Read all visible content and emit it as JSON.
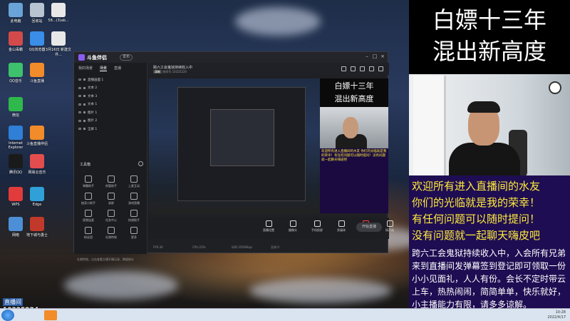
{
  "desktop": {
    "icons": [
      {
        "label": "此电脑",
        "color": "#6aa3d8"
      },
      {
        "label": "回收站",
        "color": "#b8c4d0"
      },
      {
        "label": "58...(3)ab...",
        "color": "#e8e8e8"
      },
      {
        "label": "金山毒霸",
        "color": "#d24a4a"
      },
      {
        "label": "QQ浏览器",
        "color": "#3a8ee8"
      },
      {
        "label": "3月16日 新建文件...",
        "color": "#e8e8e8"
      },
      {
        "label": "QQ音乐",
        "color": "#3ec16c"
      },
      {
        "label": "斗鱼直播",
        "color": "#f28b2a"
      },
      {
        "label": "微信",
        "color": "#2fb84b"
      },
      {
        "label": "Internet Explorer",
        "color": "#2f7fd6"
      },
      {
        "label": "斗鱼直播伴侣",
        "color": "#f28b2a"
      },
      {
        "label": "腾讯QQ",
        "color": "#1a1a1a"
      },
      {
        "label": "网易云音乐",
        "color": "#e34d4d"
      },
      {
        "label": "WPS",
        "color": "#e23b3b"
      },
      {
        "label": "Edge",
        "color": "#2fa0d8"
      },
      {
        "label": "网络",
        "color": "#4d8fd6"
      },
      {
        "label": "地下城与勇士",
        "color": "#c0392b"
      }
    ],
    "id_label_prefix": "直播间",
    "id_label_number": "10325224"
  },
  "app": {
    "name": "斗鱼伴侣",
    "version_badge": "发布",
    "left_tabs": [
      "我的场景",
      "场景",
      "直播"
    ],
    "scenes": [
      "直播画面 1",
      "文本 2",
      "文本 3",
      "文本 1",
      "图片 1",
      "图片 2",
      "全屏 1"
    ],
    "tools_title": "工具箱",
    "tools": [
      "弹幕助手",
      "房管助手",
      "上麦互动",
      "抽奖小助手",
      "录屏",
      "游戏直播",
      "视频连麦",
      "任务中心",
      "快递助手",
      "粉丝团",
      "礼物特效",
      "更多"
    ],
    "bottom_note": "礼物特效，点击查看主播开播记录，数据统计",
    "preview_title": "跨六工会鬼狱持续收入中",
    "preview_room": "房间号",
    "preview_room_id": "10325224",
    "preview_badge": "清晰",
    "bottom_tools": [
      "直播设置",
      "摄像头",
      "手机投屏",
      "多媒体",
      "麦克风",
      "扬声器"
    ],
    "start_live": "开始直播",
    "status_items": [
      "FPS:30",
      "CPU:23%",
      "码率:2500Kbps",
      "丢帧:0"
    ]
  },
  "canvas": {
    "side_title_1": "白嫖十三年",
    "side_title_2": "混出新高度",
    "side_text": "欢迎所有进入直播间的水友 你们的光临就是我的荣幸！有任何问题可以随时提问！没有问题就一起聊天嗨皮吧"
  },
  "overlay": {
    "title_line1": "白嫖十三年",
    "title_line2": "混出新高度",
    "welcome_lines": [
      "欢迎所有进入直播间的水友",
      "你们的光临就是我的荣幸！",
      "有任何问题可以随时提问！",
      "没有问题就一起聊天嗨皮吧"
    ],
    "info_lines": [
      "跨六工会鬼狱持续收入中，入会所有兄弟",
      "来到直播间发弹幕签到登记即可领取一份",
      "小小见面礼，人人有份。会长不定时带云",
      "上车，热热闹闹，简简单单，快乐就好，",
      "小主播能力有限，请多多谅解。"
    ]
  },
  "taskbar": {
    "time": "10:28",
    "date": "2022/4/17"
  }
}
